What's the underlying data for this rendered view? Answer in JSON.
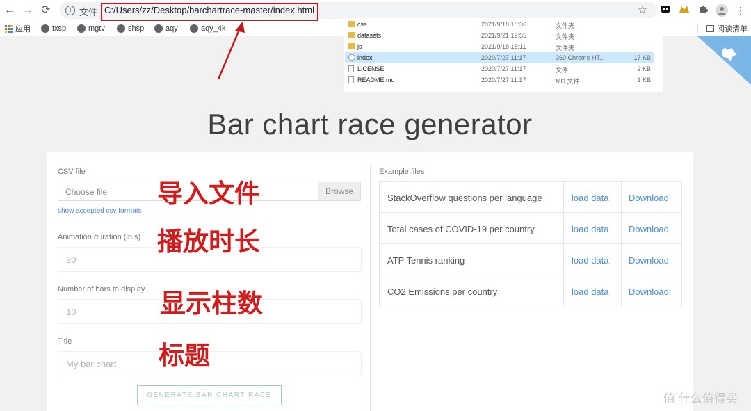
{
  "browser": {
    "scheme_label": "文件",
    "url": "C:/Users/zz/Desktop/barchartrace-master/index.html",
    "highlight_color": "#c4191c",
    "bookmarks": [
      "应用",
      "txsp",
      "mgtv",
      "shsp",
      "aqy",
      "aqy_4k"
    ],
    "reading_list": "阅读清单"
  },
  "explorer": {
    "rows": [
      {
        "name": "css",
        "date": "2021/9/18 18:36",
        "type": "文件夹",
        "size": "",
        "icon": "folder-icon"
      },
      {
        "name": "datasets",
        "date": "2021/9/21 12:55",
        "type": "文件夹",
        "size": "",
        "icon": "folder-icon"
      },
      {
        "name": "js",
        "date": "2021/9/18 18:11",
        "type": "文件夹",
        "size": "",
        "icon": "folder-icon"
      },
      {
        "name": "index",
        "date": "2020/7/27 11:17",
        "type": "360 Chrome HT...",
        "size": "17 KB",
        "icon": "html-file-icon",
        "selected": true
      },
      {
        "name": "LICENSE",
        "date": "2020/7/27 11:17",
        "type": "文件",
        "size": "2 KB",
        "icon": "file-icon"
      },
      {
        "name": "README.md",
        "date": "2020/7/27 11:17",
        "type": "MD 文件",
        "size": "1 KB",
        "icon": "file-icon"
      }
    ]
  },
  "page": {
    "title": "Bar chart race generator",
    "accent": "#4a90d9",
    "form": {
      "csv_label": "CSV file",
      "csv_placeholder": "Choose file",
      "browse_label": "Browse",
      "csv_formats_link": "show accepted csv formats",
      "duration_label": "Animation duration (in s)",
      "duration_value": "20",
      "bars_label": "Number of bars to display",
      "bars_value": "10",
      "title_label": "Title",
      "title_placeholder": "My bar chart",
      "generate_label": "GENERATE BAR CHART RACE"
    },
    "examples": {
      "label": "Example files",
      "rows": [
        {
          "name": "StackOverflow questions per language",
          "load": "load data",
          "download": "Download"
        },
        {
          "name": "Total cases of COVID-19 per country",
          "load": "load data",
          "download": "Download"
        },
        {
          "name": "ATP Tennis ranking",
          "load": "load data",
          "download": "Download"
        },
        {
          "name": "CO2 Emissions per country",
          "load": "load data",
          "download": "Download"
        }
      ]
    }
  },
  "annotations": {
    "import_file": "导入文件",
    "duration": "播放时长",
    "bar_count": "显示柱数",
    "title": "标题",
    "color": "#d01c1c"
  },
  "watermark": "值 什么值得买"
}
